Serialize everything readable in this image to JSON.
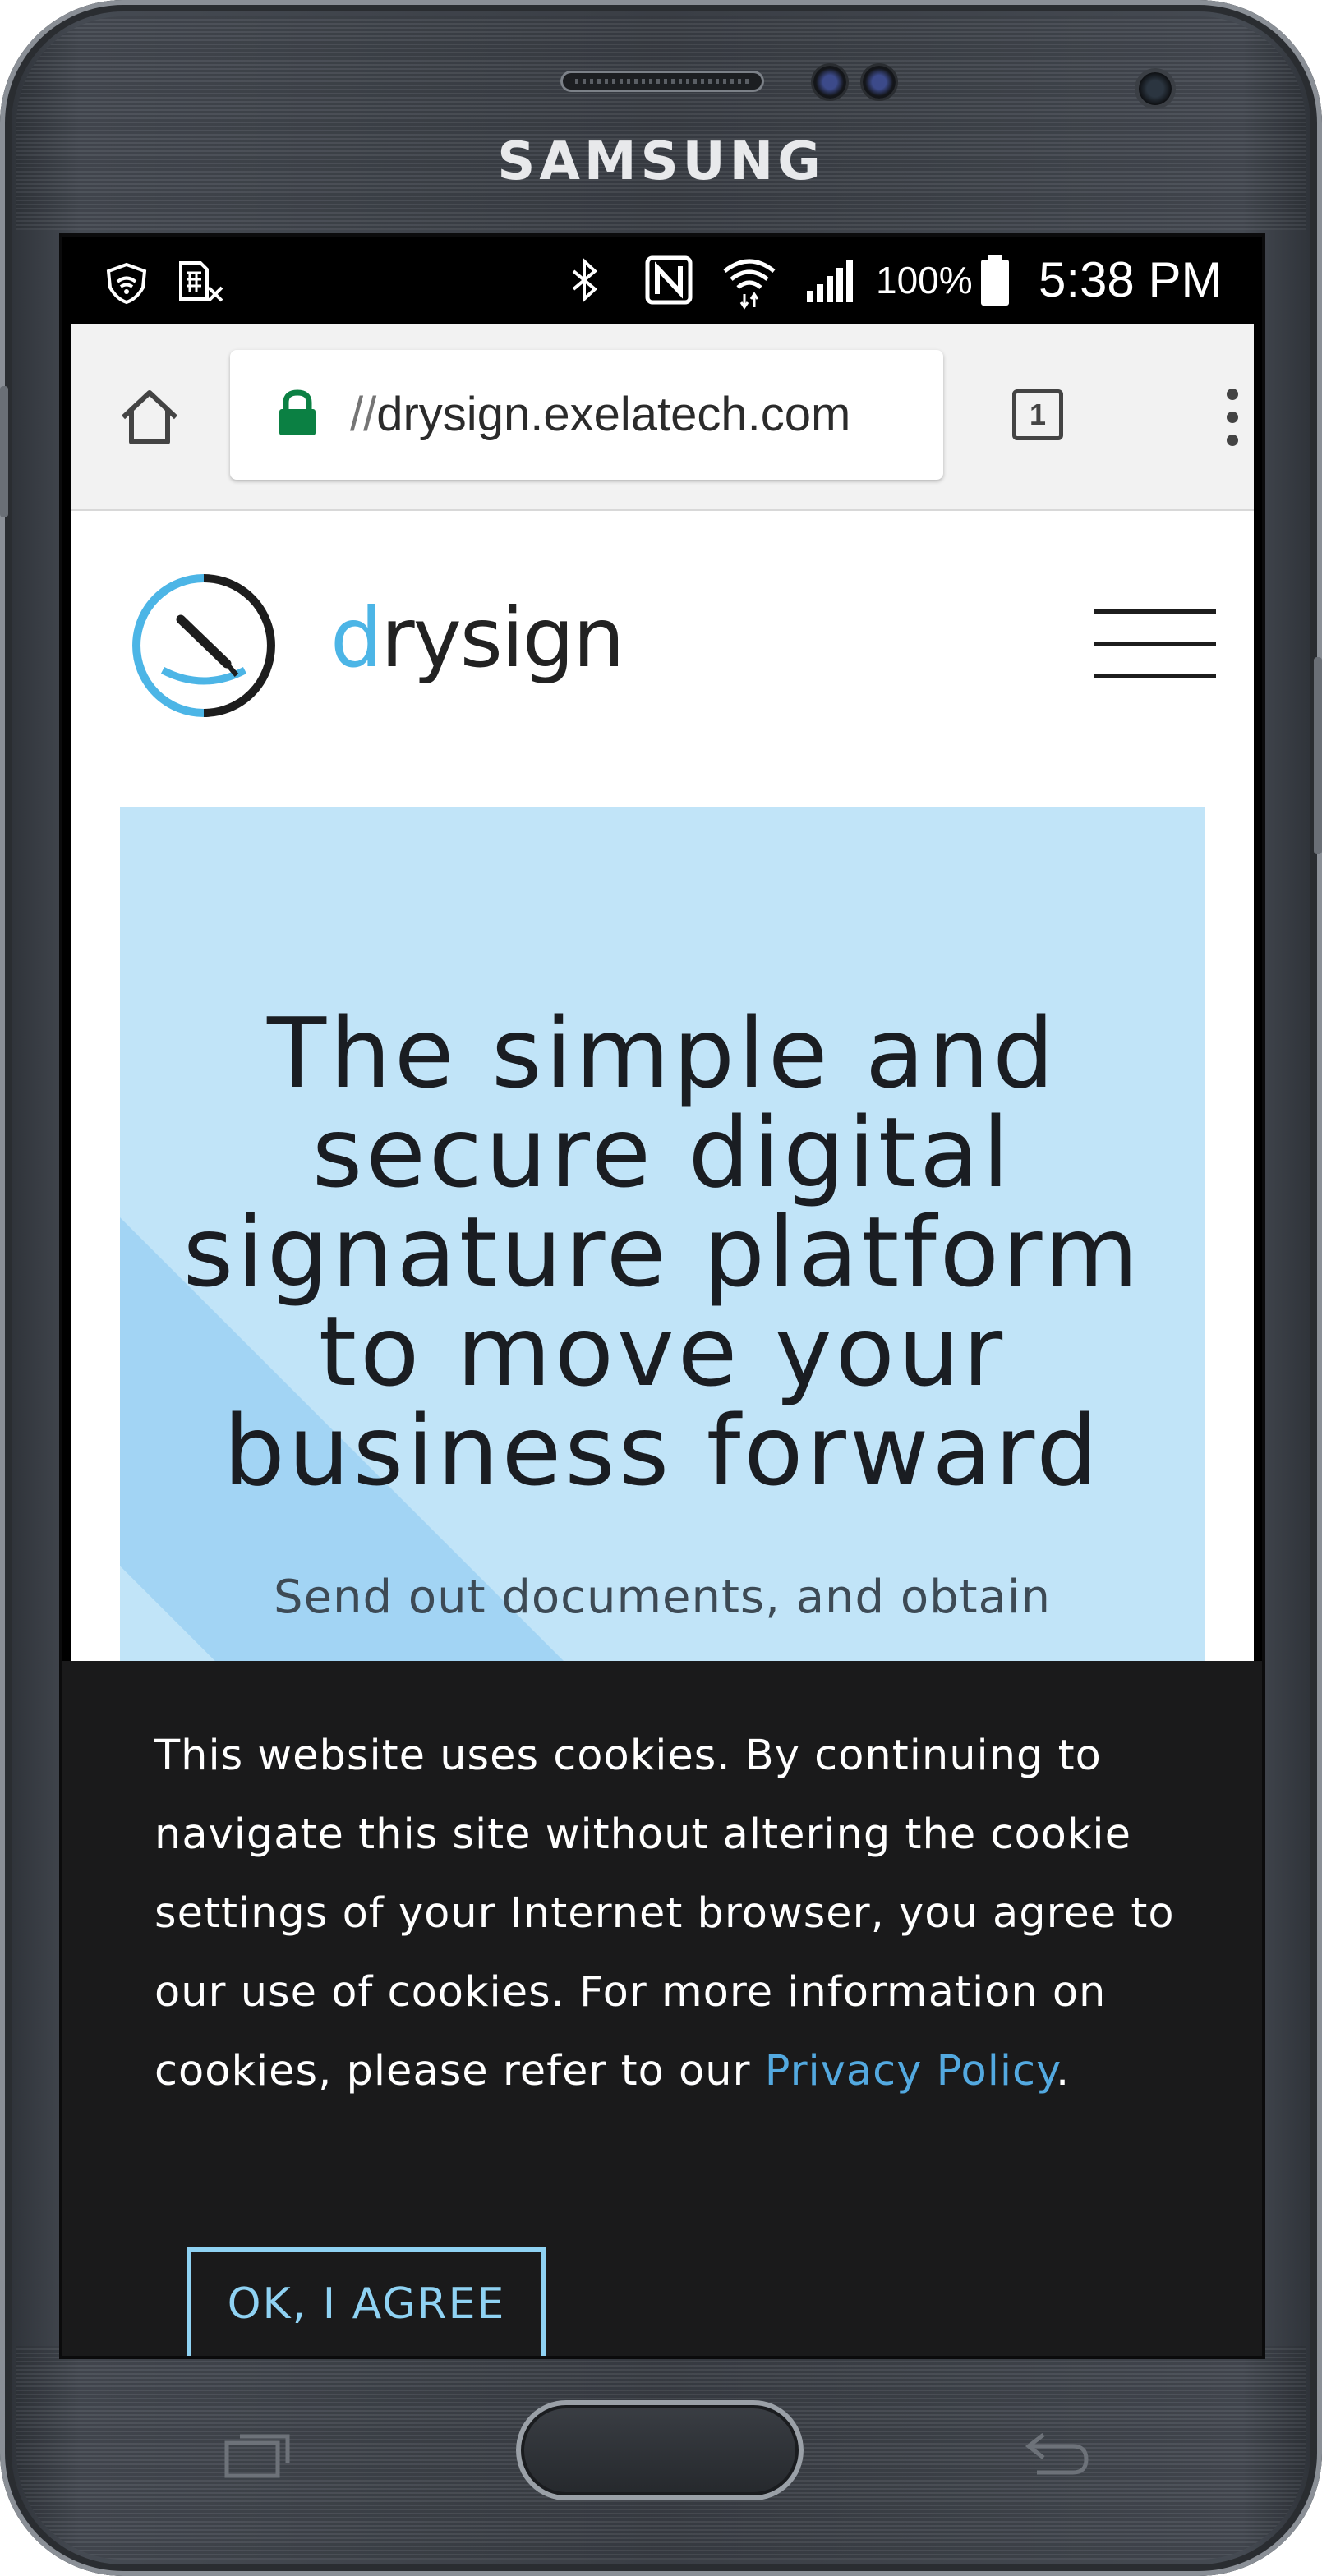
{
  "device": {
    "brand": "SAMSUNG"
  },
  "status_bar": {
    "battery": "100%",
    "time": "5:38 PM"
  },
  "browser": {
    "url_scheme": "//",
    "url_host": "drysign.exelatech.com",
    "tab_count": "1"
  },
  "site": {
    "logo_text_accent": "d",
    "logo_text_rest": "rysign",
    "hero_title_lines": [
      "The simple and",
      "secure digital",
      "signature platform",
      "to move your",
      "business forward"
    ],
    "hero_subtitle": "Send out documents, and obtain"
  },
  "cookie_banner": {
    "text": "This website uses cookies. By continuing to navigate this site without altering the cookie settings of your Internet browser, you agree to our use of cookies. For more information on cookies, please refer to our",
    "link_label": "Privacy Policy",
    "trailing": ".",
    "button_label": "OK, I AGREE"
  },
  "colors": {
    "hero_background": "#c1e4f8",
    "hero_stripe": "#a2d4f4",
    "logo_blue": "#4cb5e6",
    "link_blue": "#53a9e0",
    "cookie_bg": "#1a1a1b",
    "secure_lock_green": "#0b8043"
  }
}
